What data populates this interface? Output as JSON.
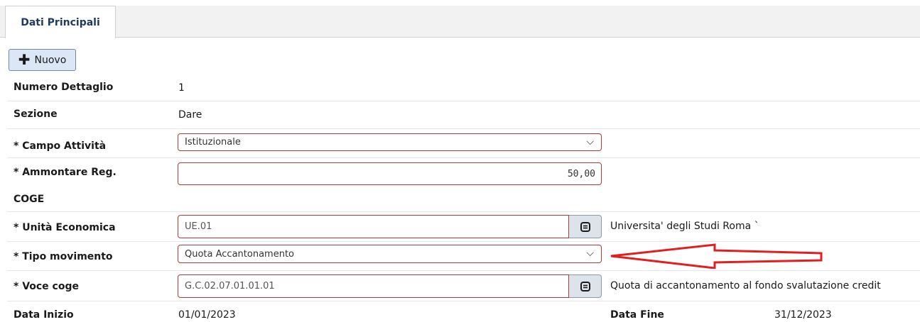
{
  "tabs": [
    {
      "label": "Dati Principali"
    }
  ],
  "toolbar": {
    "new_label": "Nuovo"
  },
  "form": {
    "numero_dettaglio": {
      "label": "Numero Dettaglio",
      "value": "1"
    },
    "sezione": {
      "label": "Sezione",
      "value": "Dare"
    },
    "campo_attivita": {
      "label": "* Campo Attività",
      "value": "Istituzionale"
    },
    "ammontare": {
      "label_line1": "* Ammontare Reg.",
      "label_line2": "COGE",
      "value": "50,00"
    },
    "unita_economica": {
      "label": "* Unità Economica",
      "value": "UE.01",
      "description": "Universita' degli Studi Roma `"
    },
    "tipo_movimento": {
      "label": "* Tipo movimento",
      "value": "Quota Accantonamento"
    },
    "voce_coge": {
      "label": "* Voce coge",
      "value": "G.C.02.07.01.01.01",
      "description": "Quota di accantonamento al fondo svalutazione credit"
    },
    "data_inizio": {
      "label": "Data Inizio",
      "value": "01/01/2023"
    },
    "data_fine": {
      "label": "Data Fine",
      "value": "31/12/2023"
    }
  },
  "icons": {
    "lookup": "lookup-icon",
    "chevron": "chevron-down-icon",
    "plus": "plus-icon"
  },
  "colors": {
    "accent": "#1e3a5f",
    "required_border": "#b03a3a",
    "arrow": "#e02020"
  }
}
